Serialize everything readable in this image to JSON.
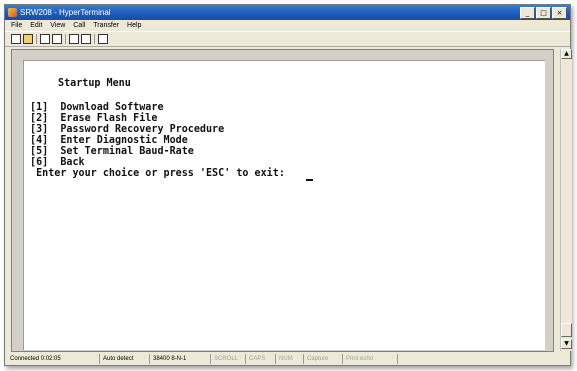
{
  "window": {
    "title": "SRW208 - HyperTerminal",
    "buttons": {
      "minimize": "_",
      "maximize": "□",
      "close": "×"
    }
  },
  "menubar": [
    "File",
    "Edit",
    "View",
    "Call",
    "Transfer",
    "Help"
  ],
  "toolbar": {
    "buttons": [
      "new-icon",
      "open-icon",
      "call-icon",
      "disconnect-icon",
      "send-icon",
      "receive-icon",
      "properties-icon"
    ]
  },
  "terminal": {
    "heading": "Startup Menu",
    "options": [
      "[1]  Download Software",
      "[2]  Erase Flash File",
      "[3]  Password Recovery Procedure",
      "[4]  Enter Diagnostic Mode",
      "[5]  Set Terminal Baud-Rate",
      "[6]  Back"
    ],
    "prompt": " Enter your choice or press 'ESC' to exit: "
  },
  "statusbar": {
    "connected": "Connected 0:02:05",
    "detect": "Auto detect",
    "settings": "38400 8-N-1",
    "scroll": "SCROLL",
    "caps": "CAPS",
    "num": "NUM",
    "capture": "Capture",
    "print_echo": "Print echo"
  }
}
